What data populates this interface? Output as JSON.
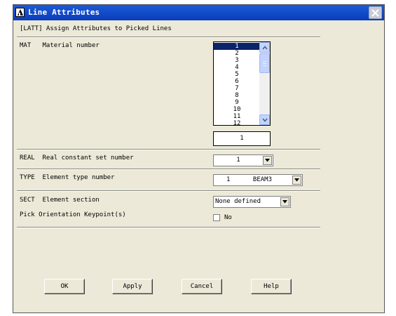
{
  "window": {
    "title": "Line Attributes",
    "subtitle": "[LATT]  Assign Attributes to Picked Lines"
  },
  "mat": {
    "label": "MAT   Material number",
    "options": [
      "1",
      "2",
      "3",
      "4",
      "5",
      "6",
      "7",
      "8",
      "9",
      "10",
      "11",
      "12"
    ],
    "selected": "1",
    "text_value": "1"
  },
  "real": {
    "label": "REAL  Real constant set number",
    "value": "1"
  },
  "type": {
    "label": "TYPE  Element type number",
    "value": "1      BEAM3"
  },
  "sect": {
    "label": "SECT  Element section",
    "value": "None defined"
  },
  "pick": {
    "label": "Pick Orientation Keypoint(s)",
    "checkbox_label": "No",
    "checked": false
  },
  "buttons": {
    "ok": "OK",
    "apply": "Apply",
    "cancel": "Cancel",
    "help": "Help"
  }
}
